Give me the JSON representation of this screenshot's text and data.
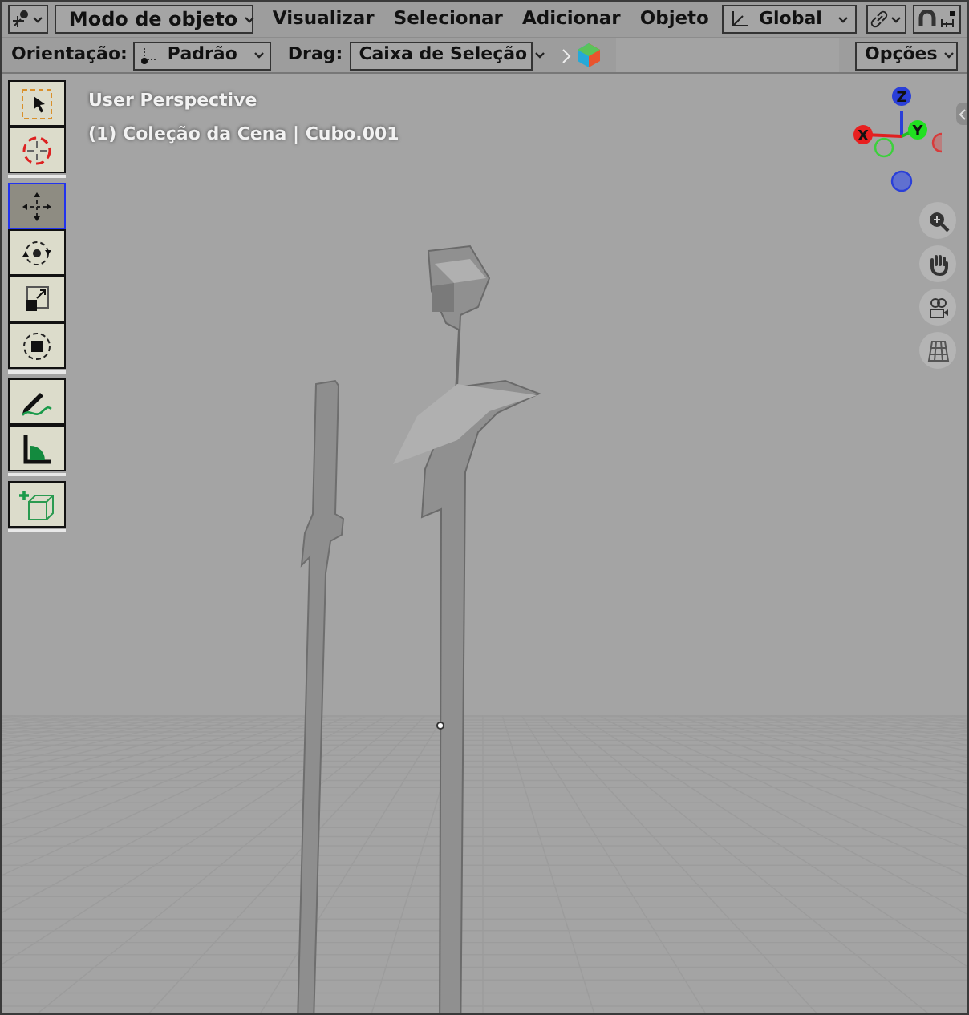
{
  "header": {
    "mode": "Modo de objeto",
    "menus": [
      "Visualizar",
      "Selecionar",
      "Adicionar",
      "Objeto"
    ],
    "transform_orientation": "Global",
    "snap": {
      "on": false
    }
  },
  "tool_settings": {
    "orientation_label": "Orientação:",
    "orientation": "Padrão",
    "drag_label": "Drag:",
    "drag": "Caixa de Seleção",
    "options": "Opções"
  },
  "viewport": {
    "view_name": "User Perspective",
    "object_info": "(1) Coleção da Cena | Cubo.001"
  },
  "tool_groups": [
    [
      {
        "kind": "select",
        "selected": false
      },
      {
        "kind": "cursor",
        "selected": false
      }
    ],
    [
      {
        "kind": "move",
        "selected": true
      },
      {
        "kind": "rotate",
        "selected": false
      },
      {
        "kind": "scale",
        "selected": false
      },
      {
        "kind": "transform",
        "selected": false
      }
    ],
    [
      {
        "kind": "annotate",
        "selected": false
      },
      {
        "kind": "measure",
        "selected": false
      }
    ],
    [
      {
        "kind": "add-cube",
        "selected": false
      }
    ]
  ],
  "gizmo": {
    "x": "X",
    "y": "Y",
    "z": "Z"
  }
}
